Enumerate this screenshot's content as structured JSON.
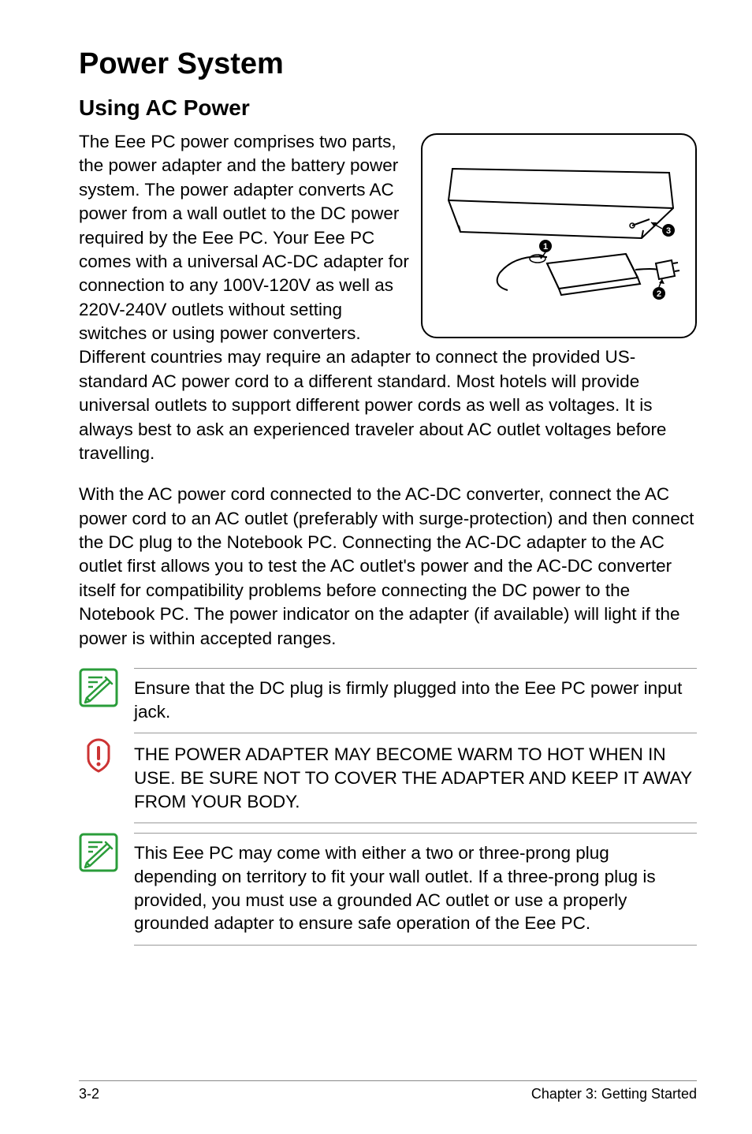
{
  "title": "Power System",
  "subtitle": "Using AC Power",
  "paragraph1": "The Eee PC power comprises two parts, the power adapter and the battery power system. The power adapter converts AC power from a wall outlet to the DC power required by the Eee PC. Your Eee PC comes with a universal AC-DC adapter for connection to any 100V-120V as well as 220V-240V outlets without setting switches or using power converters. Different countries may require an adapter to connect the provided US-standard AC power cord to a different standard. Most hotels will provide universal outlets to support different power cords as well as voltages. It is always best to ask an experienced traveler about AC outlet voltages before travelling.",
  "paragraph2": "With the AC power cord connected to the AC-DC converter, connect the AC power cord to an AC outlet (preferably with surge-protection) and then connect the DC plug to the Notebook PC. Connecting the AC-DC adapter to the AC outlet first allows you to test the AC outlet's power and the AC-DC converter itself for compatibility problems before connecting the DC power to the Notebook PC. The power indicator on the adapter (if available) will light if the power is within accepted ranges.",
  "notes": {
    "note1": "Ensure that the DC plug is firmly plugged into the Eee PC power input jack.",
    "note2": "THE POWER ADAPTER MAY BECOME WARM TO HOT WHEN IN USE. BE SURE NOT TO COVER THE ADAPTER AND KEEP IT AWAY FROM YOUR BODY.",
    "note3": "This Eee PC may come with either a two or three-prong plug depending on territory to fit your wall outlet. If a three-prong plug is provided, you must use a grounded AC outlet or use a properly grounded adapter to ensure safe operation of the Eee PC."
  },
  "diagram": {
    "callouts": [
      "1",
      "2",
      "3"
    ]
  },
  "footer": {
    "page": "3-2",
    "chapter": "Chapter 3: Getting Started"
  }
}
